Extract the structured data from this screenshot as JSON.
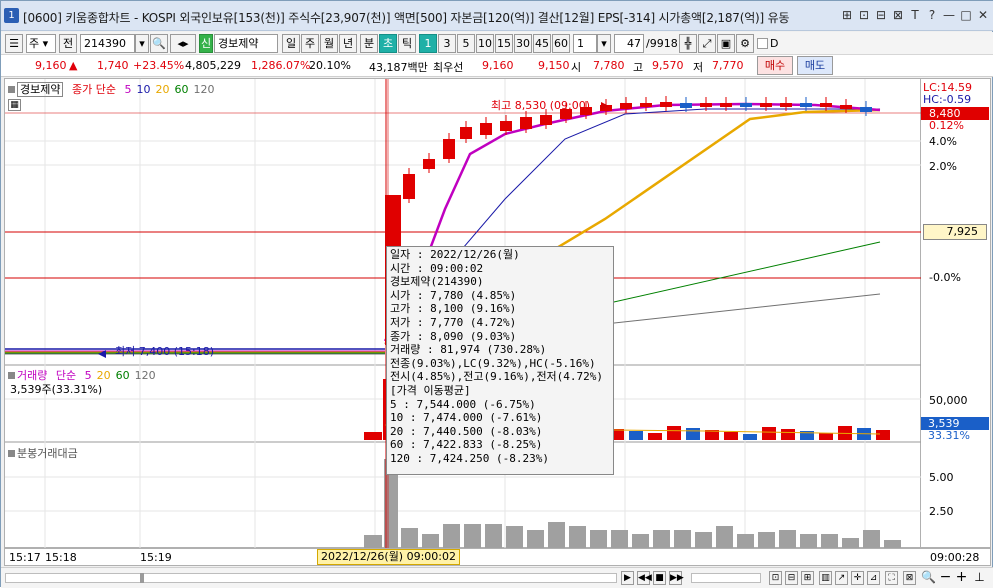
{
  "titlebar": {
    "badge": "1",
    "title": "[0600] 키움종합차트 - KOSPI 외국인보유[153(천)] 주식수[23,907(천)] 액면[500] 자본금[120(억)] 결산[12월] EPS[-314] 시가총액[2,187(억)] 유동",
    "icons": [
      "⊞",
      "⊡",
      "⊟",
      "⊠",
      "T",
      "?",
      "—",
      "□",
      "✕"
    ]
  },
  "toolbar": {
    "market": "주",
    "period_prev": "전",
    "code": "214390",
    "stock_name": "경보제약",
    "new_flag": "신",
    "periods": [
      "일",
      "주",
      "월",
      "년",
      "분",
      "초",
      "틱"
    ],
    "active_period": "초",
    "intervals": [
      "1",
      "3",
      "5",
      "10",
      "15",
      "30",
      "45",
      "60"
    ],
    "active_interval": "1",
    "interval_value": "1",
    "count": "47",
    "count_total": "/9918",
    "checkbox_label": "D"
  },
  "quote": {
    "price": "9,160",
    "change_arrow": "▲",
    "change": "1,740",
    "change_rate": "+23.45%",
    "volume": "4,805,229",
    "volume_rate": "1,286.07%",
    "turnover_rate": "20.10%",
    "amount": "43,187백만",
    "best_label": "최우선",
    "ask": "9,160",
    "bid": "9,150",
    "open_label": "시",
    "open": "7,780",
    "high_label": "고",
    "high": "9,570",
    "low_label": "저",
    "low": "7,770",
    "buy_label": "매수",
    "sell_label": "매도"
  },
  "price_panel": {
    "name": "경보제약",
    "ma_title": "종가 단순",
    "ma_periods": [
      "5",
      "10",
      "20",
      "60",
      "120"
    ],
    "ma_colors": [
      "#c000c0",
      "#1a1aa8",
      "#e8a800",
      "#008000",
      "#707070"
    ],
    "high_marker": "최고 8,530 (09:00)",
    "low_marker": "최저 7,400 (15:18)",
    "lc": "LC:14.59",
    "hc": "HC:-0.59",
    "last_price": "8,480",
    "last_pct": "0.12%",
    "ref_price": "7,925",
    "pct_ticks": [
      "4.0%",
      "2.0%",
      "-0.0%"
    ]
  },
  "volume_panel": {
    "title": "거래량",
    "ma_title": "단순",
    "ma_periods": [
      "5",
      "20",
      "60",
      "120"
    ],
    "current": "3,539주(33.31%)",
    "axis_tick": "50,000",
    "last_value": "3,539",
    "last_pct": "33.31%"
  },
  "amount_panel": {
    "title": "분봉거래대금",
    "ticks": [
      "5.00",
      "2.50"
    ]
  },
  "tooltip": {
    "rows": [
      "일자      : 2022/12/26(월)",
      "시간      : 09:00:02",
      "경보제약(214390)",
      " 시가     : 7,780 (4.85%)",
      " 고가     : 8,100 (9.16%)",
      " 저가     : 7,770 (4.72%)",
      " 종가     : 8,090 (9.03%)",
      " 거래량   : 81,974 (730.28%)",
      " 전종(9.03%),LC(9.32%),HC(-5.16%)",
      " 전시(4.85%),전고(9.16%),전저(4.72%)",
      "[가격 이동평균]",
      " 5        : 7,544.000 (-6.75%)",
      " 10       : 7,474.000 (-7.61%)",
      " 20       : 7,440.500 (-8.03%)",
      " 60       : 7,422.833 (-8.25%)",
      " 120      : 7,424.250 (-8.23%)"
    ]
  },
  "timeaxis": {
    "labels": [
      "15:17",
      "15:18",
      "15:19"
    ],
    "cursor_label": "2022/12/26(월) 09:00:02",
    "right_label": "09:00:28"
  }
}
